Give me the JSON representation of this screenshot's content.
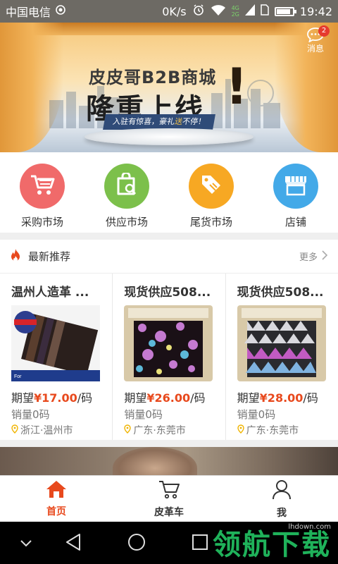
{
  "status_bar": {
    "carrier": "中国电信",
    "net_speed": "0K/s",
    "net_types": [
      "4G",
      "2G"
    ],
    "time": "19:42",
    "battery_level": 0.8
  },
  "banner": {
    "title": "皮皮哥B2B商城",
    "headline": "隆重上线",
    "exclaim": "!",
    "ribbon_prefix": "入驻有惊喜，豪礼",
    "ribbon_highlight": "送",
    "ribbon_suffix": "不停！",
    "slide_count": 3,
    "active_slide": 0
  },
  "message": {
    "label": "消息",
    "badge": "2"
  },
  "categories": [
    {
      "label": "采购市场",
      "icon": "cart-icon",
      "color": "#f06a6a"
    },
    {
      "label": "供应市场",
      "icon": "bag-search-icon",
      "color": "#7cc04b"
    },
    {
      "label": "尾货市场",
      "icon": "tag-icon",
      "color": "#f7a823"
    },
    {
      "label": "店铺",
      "icon": "store-icon",
      "color": "#43a9e8"
    }
  ],
  "recommend": {
    "title": "最新推荐",
    "more": "更多",
    "products": [
      {
        "title": "温州人造革 ...",
        "price_prefix": "期望",
        "price": "¥17.00",
        "unit": "/码",
        "sales": "销量0码",
        "location": "浙江·温州市"
      },
      {
        "title": "现货供应508...",
        "price_prefix": "期望",
        "price": "¥26.00",
        "unit": "/码",
        "sales": "销量0码",
        "location": "广东·东莞市"
      },
      {
        "title": "现货供应508...",
        "price_prefix": "期望",
        "price": "¥28.00",
        "unit": "/码",
        "sales": "销量0码",
        "location": "广东·东莞市"
      }
    ]
  },
  "tabs": [
    {
      "label": "首页",
      "icon": "home-icon",
      "active": true
    },
    {
      "label": "皮革车",
      "icon": "cart-icon",
      "active": false
    },
    {
      "label": "我",
      "icon": "person-icon",
      "active": false
    }
  ],
  "watermark": {
    "url": "lhdown.com",
    "text": "领航下载"
  },
  "colors": {
    "accent": "#e8491d",
    "status_bar": "#6d6a64"
  }
}
